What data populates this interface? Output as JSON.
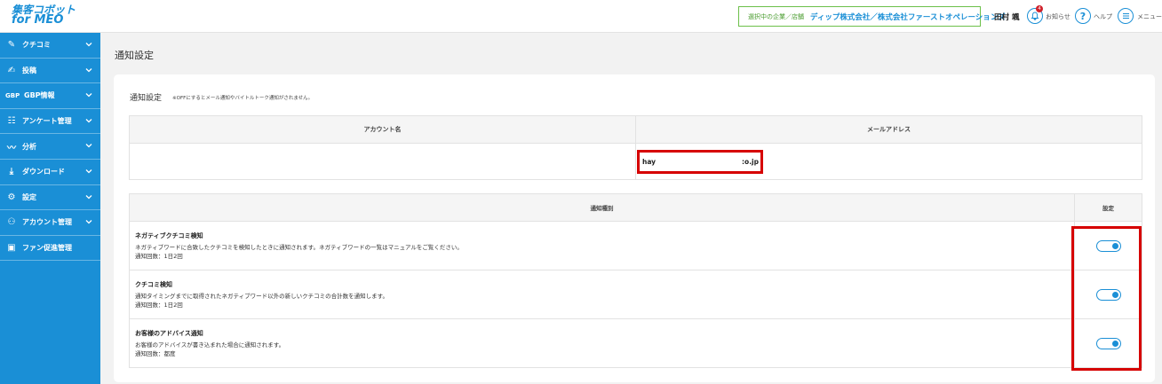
{
  "header": {
    "logo_line1": "集客コボット",
    "logo_line2": "for MEO",
    "company_label": "選択中の企業／店舗",
    "company_value": "ディップ株式会社／株式会社ファーストオペレーションズ",
    "username": "田村 颯",
    "notification_count": "4",
    "notification_label": "お知らせ",
    "help_label": "ヘルプ",
    "menu_label": "メニュー"
  },
  "sidebar": {
    "items": [
      {
        "label": "クチコミ",
        "icon": "review-icon",
        "glyph": "✎",
        "chevron": true
      },
      {
        "label": "投稿",
        "icon": "post-icon",
        "glyph": "✍",
        "chevron": true
      },
      {
        "label": "GBP情報",
        "icon": "gbp-icon",
        "glyph": "GBP",
        "chevron": true
      },
      {
        "label": "アンケート管理",
        "icon": "survey-icon",
        "glyph": "☷",
        "chevron": true
      },
      {
        "label": "分析",
        "icon": "analysis-icon",
        "glyph": "〰",
        "chevron": true
      },
      {
        "label": "ダウンロード",
        "icon": "download-icon",
        "glyph": "⤓",
        "chevron": true
      },
      {
        "label": "設定",
        "icon": "gear-icon",
        "glyph": "⚙",
        "chevron": true
      },
      {
        "label": "アカウント管理",
        "icon": "account-icon",
        "glyph": "⚇",
        "chevron": true
      },
      {
        "label": "ファン促進管理",
        "icon": "fan-card-icon",
        "glyph": "▣",
        "chevron": false
      }
    ]
  },
  "main": {
    "page_title": "通知設定",
    "section_title": "通知設定",
    "section_note": "※OFFにするとメール通知やバイトルトーク通知がされません。",
    "account_table": {
      "col_account": "アカウント名",
      "col_email": "メールアドレス",
      "account_name": "",
      "email_start": "hay",
      "email_end": ":o.jp"
    },
    "notify_table": {
      "col_type": "通知種別",
      "col_setting": "設定",
      "rows": [
        {
          "title": "ネガティブクチコミ検知",
          "desc": "ネガティブワードに合致したクチコミを検知したときに通知されます。ネガティブワードの一覧はマニュアルをご覧ください。",
          "freq": "通知回数：1日2回",
          "enabled": true
        },
        {
          "title": "クチコミ検知",
          "desc": "通知タイミングまでに取得されたネガティブワード以外の新しいクチコミの合計数を通知します。",
          "freq": "通知回数：1日2回",
          "enabled": true
        },
        {
          "title": "お客様のアドバイス通知",
          "desc": "お客様のアドバイスが書き込まれた場合に通知されます。",
          "freq": "通知回数：都度",
          "enabled": true
        }
      ]
    }
  },
  "colors": {
    "accent": "#1a8fd6",
    "highlight": "#d60000",
    "company_border": "#6cc04a"
  }
}
